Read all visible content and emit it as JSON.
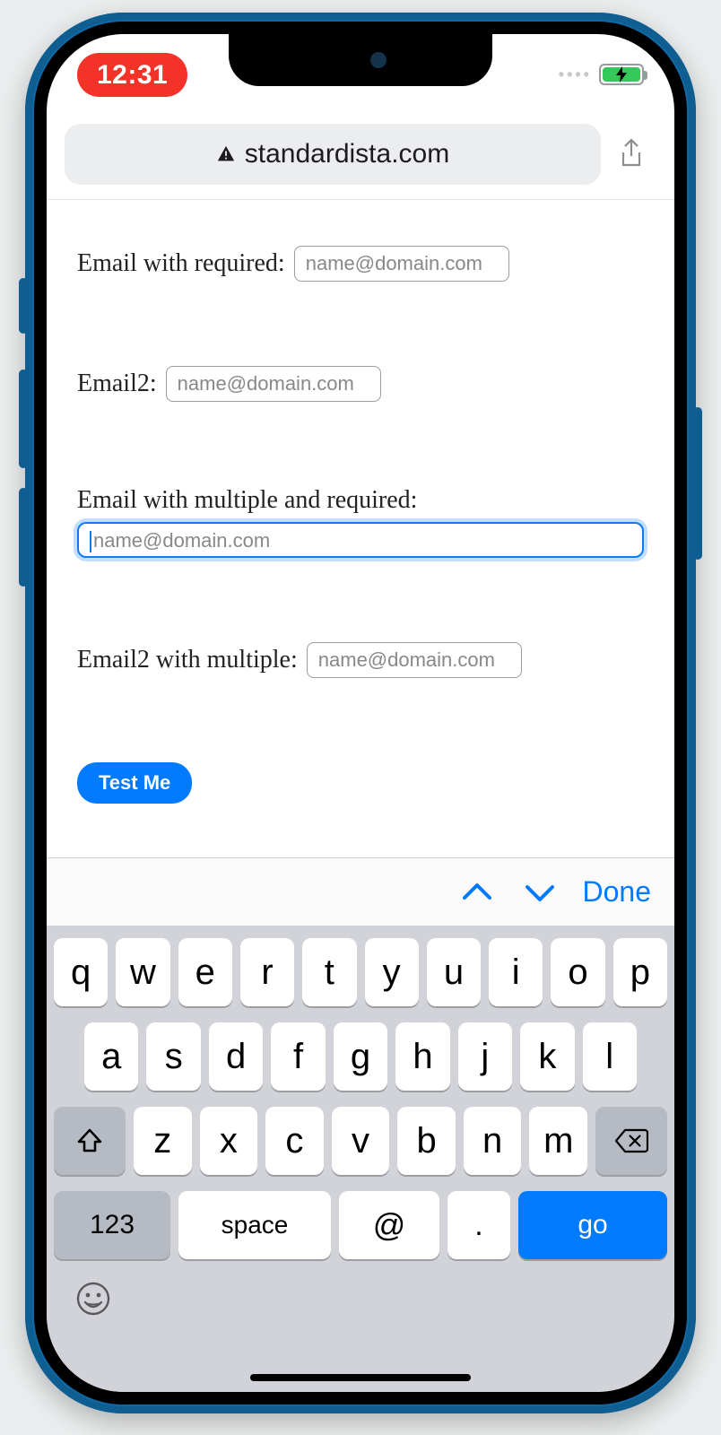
{
  "status_bar": {
    "time": "12:31"
  },
  "browser": {
    "domain": "standardista.com"
  },
  "form": {
    "fields": [
      {
        "label": "Email with required:",
        "placeholder": "name@domain.com"
      },
      {
        "label": "Email2:",
        "placeholder": "name@domain.com"
      },
      {
        "label": "Email with multiple and required:",
        "placeholder": "name@domain.com"
      },
      {
        "label": "Email2 with multiple:",
        "placeholder": "name@domain.com"
      }
    ],
    "submit_label": "Test Me"
  },
  "keyboard_accessory": {
    "done_label": "Done"
  },
  "keyboard": {
    "row1": [
      "q",
      "w",
      "e",
      "r",
      "t",
      "y",
      "u",
      "i",
      "o",
      "p"
    ],
    "row2": [
      "a",
      "s",
      "d",
      "f",
      "g",
      "h",
      "j",
      "k",
      "l"
    ],
    "row3": [
      "z",
      "x",
      "c",
      "v",
      "b",
      "n",
      "m"
    ],
    "numeric_label": "123",
    "space_label": "space",
    "at_label": "@",
    "dot_label": ".",
    "go_label": "go"
  }
}
